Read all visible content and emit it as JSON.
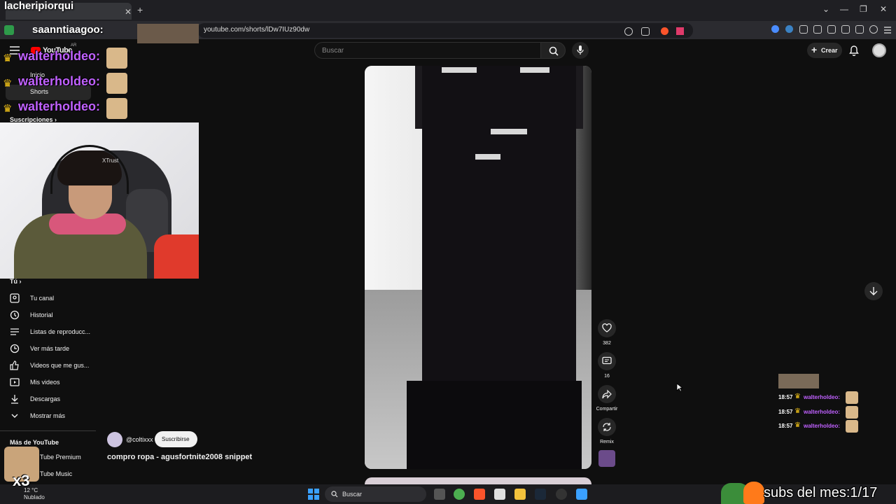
{
  "browser": {
    "url": "youtube.com/shorts/lDw7IUz90dw"
  },
  "youtube": {
    "logo": "YouTube",
    "region": "AR",
    "search_placeholder": "Buscar",
    "create_label": "Crear"
  },
  "sidebar": {
    "top_items": [
      {
        "label": "Inicio",
        "icon": "home-icon"
      },
      {
        "label": "Shorts",
        "icon": "shorts-icon"
      }
    ],
    "subscriptions_heading": "Suscripciones",
    "you_heading": "Tú",
    "you_items": [
      {
        "label": "Tu canal",
        "icon": "channel-icon"
      },
      {
        "label": "Historial",
        "icon": "history-icon"
      },
      {
        "label": "Listas de reproducc...",
        "icon": "playlist-icon"
      },
      {
        "label": "Ver más tarde",
        "icon": "clock-icon"
      },
      {
        "label": "Videos que me gus...",
        "icon": "like-icon"
      },
      {
        "label": "Mis videos",
        "icon": "video-icon"
      },
      {
        "label": "Descargas",
        "icon": "download-icon"
      },
      {
        "label": "Mostrar más",
        "icon": "chevron-down-icon"
      }
    ],
    "more_heading": "Más de YouTube",
    "more_items": [
      {
        "label": "Tube Premium"
      },
      {
        "label": "Tube Music"
      }
    ]
  },
  "short": {
    "channel": "@coltixxx",
    "subscribe_label": "Suscribirse",
    "title": "compro ropa - agusfortnite2008 snippet",
    "likes": "382",
    "comments": "16",
    "share_label": "Compartir",
    "remix_label": "Remix"
  },
  "overlay": {
    "streamer_title": "lacheripiorqui",
    "chat_user": "walterholdeo:",
    "second_user": "saanntiaagoo:",
    "webcam_brand": "XTrust",
    "right_chat": [
      {
        "time": "18:57",
        "name": "walterholdeo:"
      },
      {
        "time": "18:57",
        "name": "walterholdeo:"
      },
      {
        "time": "18:57",
        "name": "walterholdeo:"
      }
    ],
    "multiplier": "x3",
    "subs_month": "subs del mes:1/17"
  },
  "taskbar": {
    "temp": "12 °C",
    "weather": "Nublado",
    "search_label": "Buscar"
  }
}
